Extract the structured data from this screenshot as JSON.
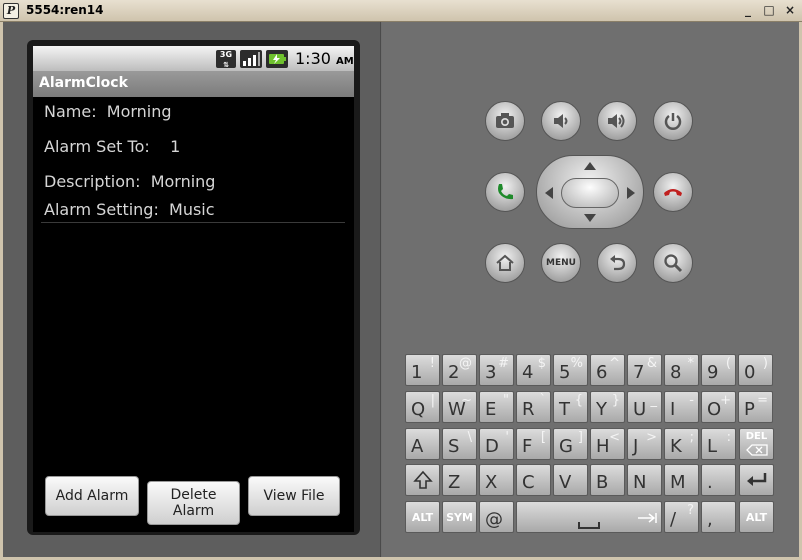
{
  "window": {
    "title": "5554:ren14",
    "app_icon_letter": "P",
    "minimize_glyph": "_",
    "maximize_glyph": "□",
    "close_glyph": "×"
  },
  "statusbar": {
    "network": "3G",
    "time": "1:30",
    "ampm": "AM"
  },
  "app": {
    "title": "AlarmClock",
    "name_line": "Name:  Morning",
    "alarm_set_line": "Alarm Set To:    1",
    "description_line": "Description:  Morning",
    "setting_line": "Alarm Setting:  Music",
    "buttons": {
      "add": "Add Alarm",
      "delete": "Delete\nAlarm",
      "view": "View File"
    }
  },
  "controls": {
    "menu_label": "MENU"
  },
  "keyboard": {
    "row1": [
      {
        "main": "1",
        "alt": "!"
      },
      {
        "main": "2",
        "alt": "@"
      },
      {
        "main": "3",
        "alt": "#"
      },
      {
        "main": "4",
        "alt": "$"
      },
      {
        "main": "5",
        "alt": "%"
      },
      {
        "main": "6",
        "alt": "^"
      },
      {
        "main": "7",
        "alt": "&"
      },
      {
        "main": "8",
        "alt": "*"
      },
      {
        "main": "9",
        "alt": "("
      },
      {
        "main": "0",
        "alt": ")"
      }
    ],
    "row2": [
      {
        "main": "Q",
        "alt": "|"
      },
      {
        "main": "W",
        "alt": "~"
      },
      {
        "main": "E",
        "alt": "\""
      },
      {
        "main": "R",
        "alt": "`"
      },
      {
        "main": "T",
        "alt": "{"
      },
      {
        "main": "Y",
        "alt": "}"
      },
      {
        "main": "U",
        "alt": "_"
      },
      {
        "main": "I",
        "alt": "-"
      },
      {
        "main": "O",
        "alt": "+"
      },
      {
        "main": "P",
        "alt": "="
      }
    ],
    "row3": [
      {
        "main": "A",
        "alt": ""
      },
      {
        "main": "S",
        "alt": "\\"
      },
      {
        "main": "D",
        "alt": "'"
      },
      {
        "main": "F",
        "alt": "["
      },
      {
        "main": "G",
        "alt": "]"
      },
      {
        "main": "H",
        "alt": "<"
      },
      {
        "main": "J",
        "alt": ">"
      },
      {
        "main": "K",
        "alt": ";"
      },
      {
        "main": "L",
        "alt": ":"
      }
    ],
    "del_label": "DEL",
    "row4": [
      {
        "main": "Z",
        "alt": ""
      },
      {
        "main": "X",
        "alt": ""
      },
      {
        "main": "C",
        "alt": ""
      },
      {
        "main": "V",
        "alt": ""
      },
      {
        "main": "B",
        "alt": ""
      },
      {
        "main": "N",
        "alt": ""
      },
      {
        "main": "M",
        "alt": ""
      },
      {
        "main": ".",
        "alt": ""
      }
    ],
    "alt_label": "ALT",
    "sym_label": "SYM",
    "at_label": "@",
    "slash_main": "/",
    "slash_alt": "?",
    "comma_label": ","
  }
}
